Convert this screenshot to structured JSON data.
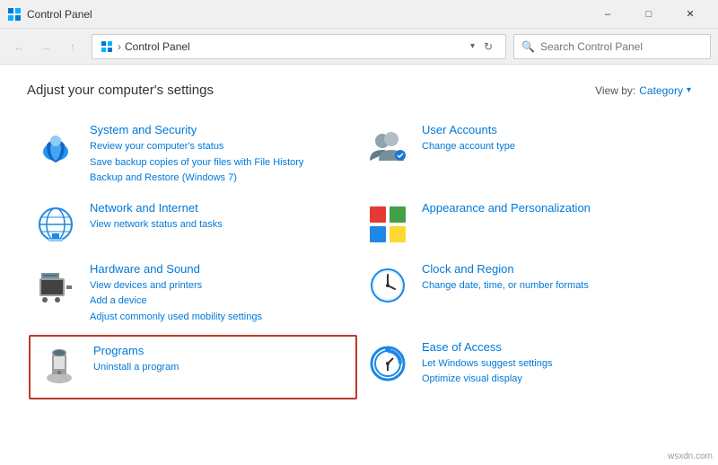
{
  "titleBar": {
    "title": "Control Panel",
    "minimizeLabel": "–",
    "maximizeLabel": "□",
    "closeLabel": "✕"
  },
  "navBar": {
    "backLabel": "←",
    "forwardLabel": "→",
    "upLabel": "↑",
    "addressText": "Control Panel",
    "refreshLabel": "↻",
    "searchPlaceholder": "Search Control Panel"
  },
  "main": {
    "pageTitle": "Adjust your computer's settings",
    "viewBy": "View by:",
    "viewByValue": "Category",
    "categories": [
      {
        "id": "system-security",
        "title": "System and Security",
        "links": [
          "Review your computer's status",
          "Save backup copies of your files with File History",
          "Backup and Restore (Windows 7)"
        ],
        "highlighted": false
      },
      {
        "id": "user-accounts",
        "title": "User Accounts",
        "links": [
          "Change account type"
        ],
        "highlighted": false
      },
      {
        "id": "network-internet",
        "title": "Network and Internet",
        "links": [
          "View network status and tasks"
        ],
        "highlighted": false
      },
      {
        "id": "appearance",
        "title": "Appearance and Personalization",
        "links": [],
        "highlighted": false
      },
      {
        "id": "hardware-sound",
        "title": "Hardware and Sound",
        "links": [
          "View devices and printers",
          "Add a device",
          "Adjust commonly used mobility settings"
        ],
        "highlighted": false
      },
      {
        "id": "clock-region",
        "title": "Clock and Region",
        "links": [
          "Change date, time, or number formats"
        ],
        "highlighted": false
      },
      {
        "id": "programs",
        "title": "Programs",
        "links": [
          "Uninstall a program"
        ],
        "highlighted": true
      },
      {
        "id": "ease-access",
        "title": "Ease of Access",
        "links": [
          "Let Windows suggest settings",
          "Optimize visual display"
        ],
        "highlighted": false
      }
    ]
  },
  "watermark": "wsxdn.com"
}
